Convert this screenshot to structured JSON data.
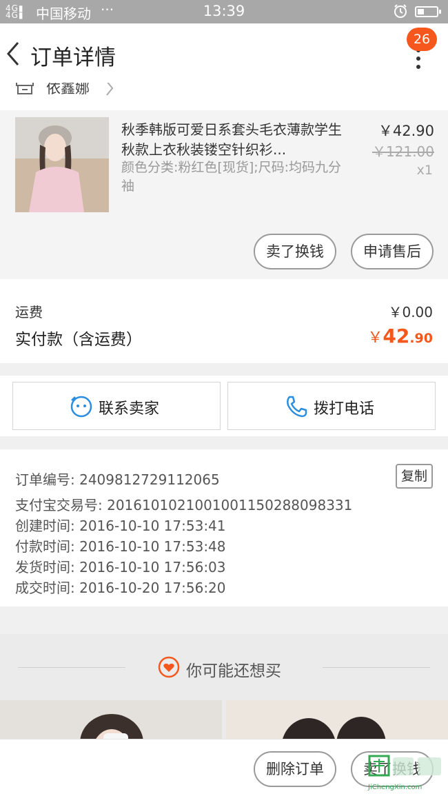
{
  "status_bar": {
    "network": "4G 4G",
    "carrier": "中国移动",
    "dots": "···",
    "time": "13:39"
  },
  "nav": {
    "title": "订单详情",
    "badge_count": "26"
  },
  "shop": {
    "name": "依鑫娜"
  },
  "item": {
    "name": "秋季韩版可爱日系套头毛衣薄款学生秋款上衣秋装镂空针织衫...",
    "spec": "颜色分类:粉红色[现货];尺码:均码九分袖",
    "price": "￥42.90",
    "original_price": "￥121.00",
    "quantity": "x1",
    "sell_button": "卖了换钱",
    "after_sale_button": "申请售后"
  },
  "totals": {
    "shipping_label": "运费",
    "shipping_value": "￥0.00",
    "paid_label": "实付款（含运费）",
    "paid_yen": "￥",
    "paid_int": "42",
    "paid_dec": ".90"
  },
  "contact": {
    "seller_label": "联系卖家",
    "phone_label": "拨打电话"
  },
  "order_info": {
    "copy_button": "复制",
    "rows": [
      "订单编号: 2409812729112065",
      "支付宝交易号: 2016101021001001150288098331",
      "创建时间: 2016-10-10 17:53:41",
      "付款时间: 2016-10-10 17:53:48",
      "发货时间: 2016-10-10 17:56:03",
      "成交时间: 2016-10-20 17:56:20"
    ]
  },
  "recommend": {
    "title": "你可能还想买"
  },
  "bottom": {
    "delete_button": "删除订单",
    "sell_button": "卖了换钱",
    "watermark": "JiChengXin.com"
  },
  "colors": {
    "accent": "#f5571c",
    "icon_blue": "#2a8de0"
  }
}
